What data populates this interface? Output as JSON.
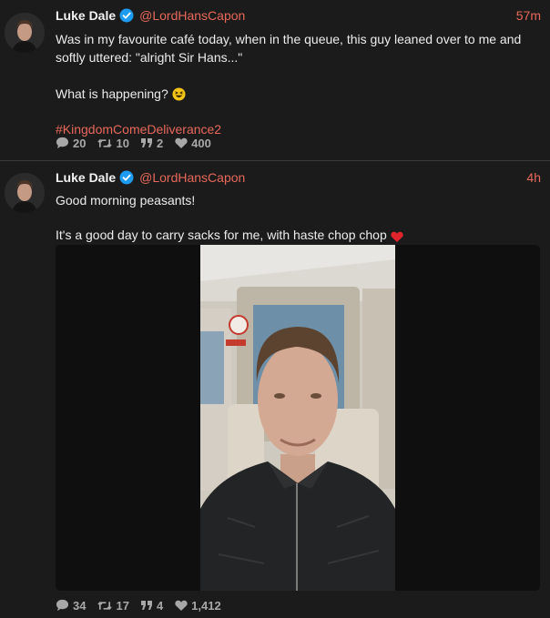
{
  "tweets": [
    {
      "author": {
        "name": "Luke Dale",
        "handle": "@LordHansCapon"
      },
      "time": "57m",
      "lines": [
        "Was in my favourite café today, when in the queue, this guy leaned over to me and softly uttered: \"alright Sir Hans...\"",
        "What is happening?"
      ],
      "hashtag": "#KingdomComeDeliverance2",
      "stats": {
        "replies": "20",
        "retweets": "10",
        "quotes": "2",
        "likes": "400"
      }
    },
    {
      "author": {
        "name": "Luke Dale",
        "handle": "@LordHansCapon"
      },
      "time": "4h",
      "lines": [
        "Good morning peasants!",
        "It's a good day to carry sacks for me, with haste chop chop"
      ],
      "stats": {
        "replies": "34",
        "retweets": "17",
        "quotes": "4",
        "likes": "1,412"
      }
    }
  ],
  "colors": {
    "accent": "#e8685a",
    "verified": "#1d9bf0",
    "heart": "#e0242c",
    "background": "#1b1b1b"
  },
  "icons": [
    "verified-badge-icon",
    "grinning-squint-emoji-icon",
    "red-heart-emoji-icon",
    "reply-icon",
    "retweet-icon",
    "quote-icon",
    "like-icon"
  ]
}
